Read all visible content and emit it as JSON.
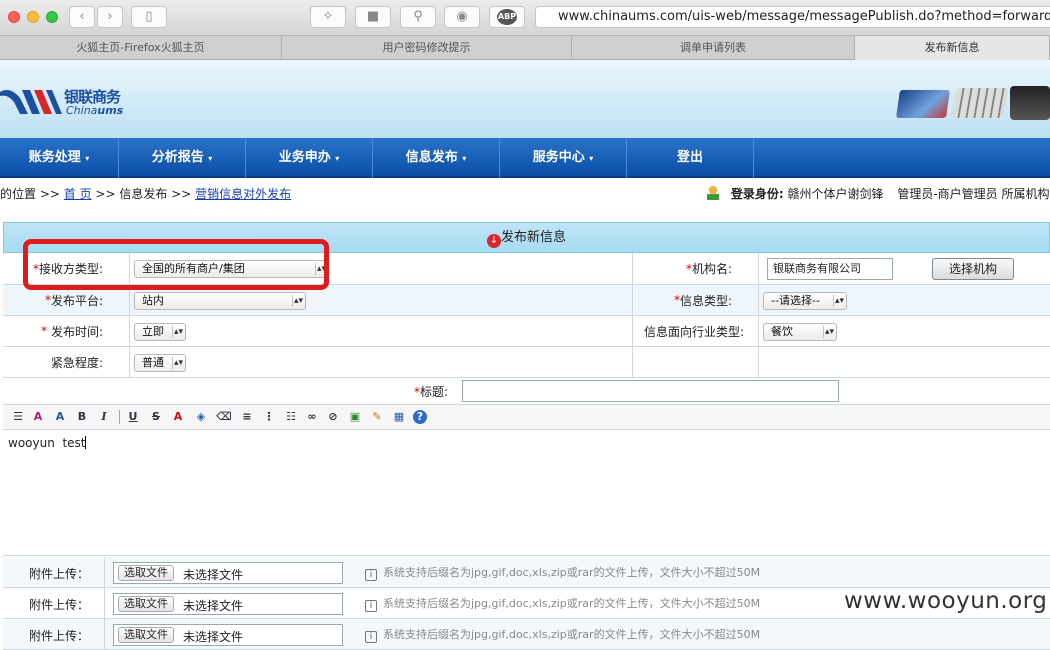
{
  "browser": {
    "url": "www.chinaums.com/uis-web/message/messagePublish.do?method=forwardToMessag",
    "abp_label": "ABP",
    "tabs": [
      {
        "label": "火狐主页-Firefox火狐主页"
      },
      {
        "label": "用户密码修改提示"
      },
      {
        "label": "调单申请列表"
      },
      {
        "label": "发布新信息"
      }
    ]
  },
  "logo": {
    "cn": "银联商务",
    "en1": "China",
    "en2": "ums"
  },
  "nav": [
    "账务处理",
    "分析报告",
    "业务申办",
    "信息发布",
    "服务中心",
    "登出"
  ],
  "breadcrumb": {
    "prefix": "您的位置 >>",
    "home": "首 页",
    "sep1": ">>",
    "mid": "信息发布",
    "sep2": ">>",
    "current": "营销信息对外发布",
    "login_label": "登录身份:",
    "login_value": "赣州个体户谢剑锋",
    "role": "管理员-商户管理员 所属机构"
  },
  "form": {
    "title": "发布新信息",
    "receiver_type_label": "接收方类型:",
    "receiver_type_value": "全国的所有商户/集团",
    "org_name_label": "机构名:",
    "org_name_value": "银联商务有限公司",
    "select_org_button": "选择机构",
    "platform_label": "发布平台:",
    "platform_value": "站内",
    "info_type_label": "信息类型:",
    "info_type_value": "--请选择--",
    "publish_time_label": "发布时间:",
    "publish_time_value": "立即",
    "industry_label": "信息面向行业类型:",
    "industry_value": "餐饮",
    "urgency_label": "紧急程度:",
    "urgency_value": "普通",
    "subject_label": "标题:",
    "subject_value": "",
    "required_mark": "*"
  },
  "editor": {
    "content": "wooyun  test"
  },
  "uploads": [
    {
      "label": "附件上传：",
      "button": "选取文件",
      "status": "未选择文件",
      "hint": "系统支持后缀名为jpg,gif,doc,xls,zip或rar的文件上传，文件大小不超过50M"
    },
    {
      "label": "附件上传：",
      "button": "选取文件",
      "status": "未选择文件",
      "hint": "系统支持后缀名为jpg,gif,doc,xls,zip或rar的文件上传，文件大小不超过50M"
    },
    {
      "label": "附件上传：",
      "button": "选取文件",
      "status": "未选择文件",
      "hint": "系统支持后缀名为jpg,gif,doc,xls,zip或rar的文件上传，文件大小不超过50M"
    }
  ],
  "watermark": "www.wooyun.org",
  "colors": {
    "nav": "#0b4ea6",
    "highlight": "#e01b1b",
    "required": "#dd0000"
  }
}
